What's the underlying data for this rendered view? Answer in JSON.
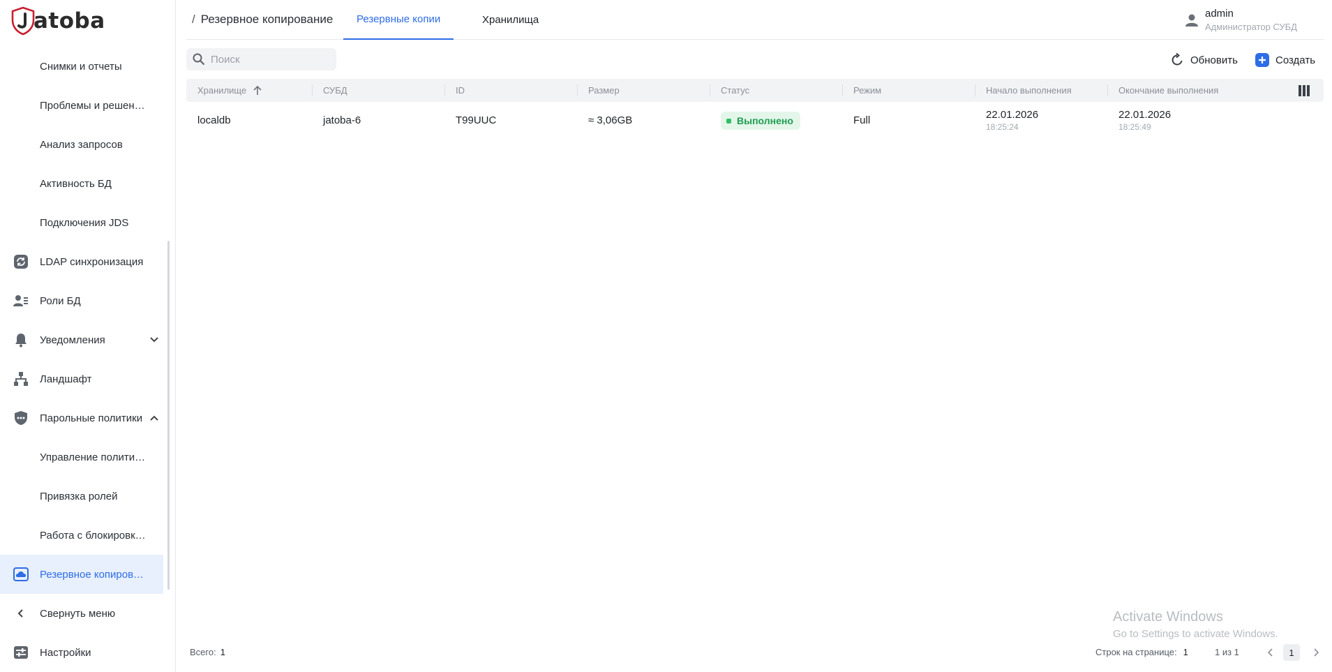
{
  "brand": {
    "logo_text": "atoba",
    "accent": "#2e6de6"
  },
  "sidebar": {
    "items": [
      {
        "label": "Снимки и отчеты",
        "icon": ""
      },
      {
        "label": "Проблемы и решения",
        "icon": ""
      },
      {
        "label": "Анализ запросов",
        "icon": ""
      },
      {
        "label": "Активность БД",
        "icon": ""
      },
      {
        "label": "Подключения JDS",
        "icon": ""
      },
      {
        "label": "LDAP синхронизация",
        "icon": "sync-icon"
      },
      {
        "label": "Роли БД",
        "icon": "user-list-icon"
      },
      {
        "label": "Уведомления",
        "icon": "bell-icon",
        "expandable": true
      },
      {
        "label": "Ландшафт",
        "icon": "network-icon"
      },
      {
        "label": "Парольные политики",
        "icon": "password-shield-icon",
        "expanded": true
      },
      {
        "label": "Управление политик…",
        "icon": ""
      },
      {
        "label": "Привязка ролей",
        "icon": ""
      },
      {
        "label": "Работа с блокировк…",
        "icon": ""
      },
      {
        "label": "Резервное копирова…",
        "icon": "backup-cloud-icon",
        "active": true
      },
      {
        "label": "Свернуть меню",
        "icon": "chevron-left-icon"
      },
      {
        "label": "Настройки",
        "icon": "settings-sliders-icon"
      }
    ]
  },
  "header": {
    "breadcrumb_sep": "/",
    "breadcrumb": "Резервное копирование",
    "tabs": [
      {
        "label": "Резервные копии",
        "active": true
      },
      {
        "label": "Хранилища",
        "active": false
      }
    ],
    "user": {
      "name": "admin",
      "role": "Администратор СУБД"
    }
  },
  "toolbar": {
    "search_placeholder": "Поиск",
    "refresh_label": "Обновить",
    "create_label": "Создать"
  },
  "table": {
    "columns": [
      "Хранилище",
      "СУБД",
      "ID",
      "Размер",
      "Статус",
      "Режим",
      "Начало выполнения",
      "Окончание выполнения"
    ],
    "rows": [
      {
        "storage": "localdb",
        "dbms": "jatoba-6",
        "id": "T99UUC",
        "size": "≈ 3,06GB",
        "status": "Выполнено",
        "mode": "Full",
        "start_date": "22.01.2026",
        "start_time": "18:25:24",
        "end_date": "22.01.2026",
        "end_time": "18:25:49"
      }
    ]
  },
  "footer": {
    "total_label": "Всего:",
    "total_value": "1",
    "rows_per_page_label": "Строк на странице:",
    "rows_per_page_value": "1",
    "range": "1 из 1",
    "page": "1"
  },
  "watermark": {
    "line1": "Activate Windows",
    "line2": "Go to Settings to activate Windows."
  }
}
